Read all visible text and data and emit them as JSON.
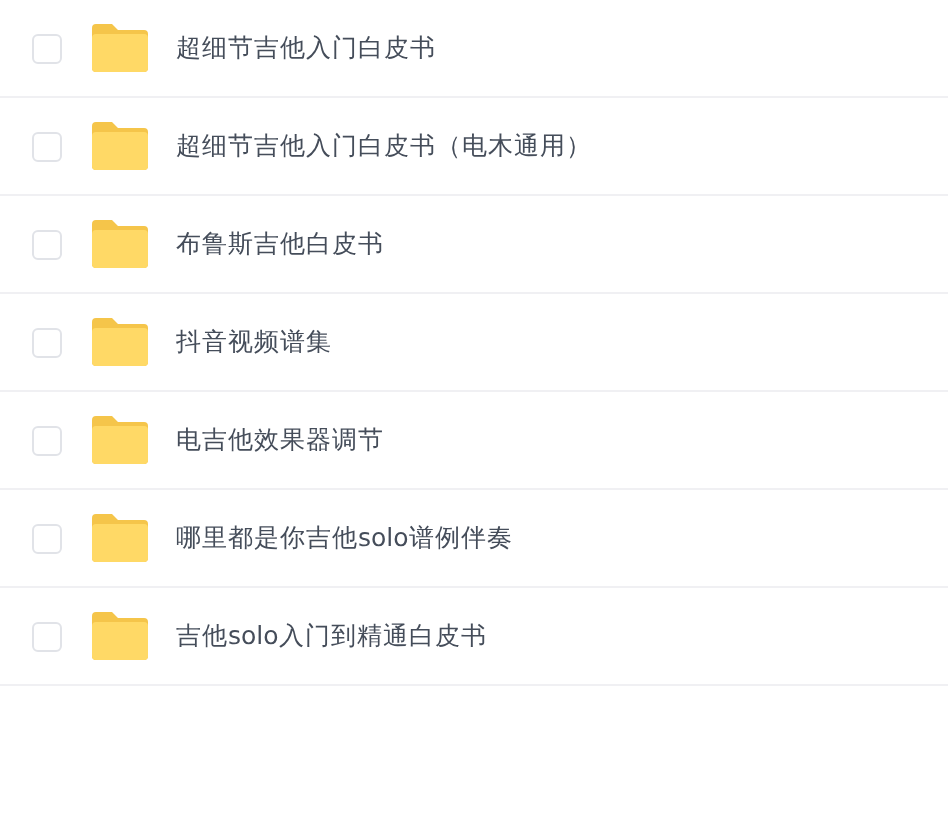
{
  "files": [
    {
      "name": "超细节吉他入门白皮书",
      "checked": false
    },
    {
      "name": "超细节吉他入门白皮书（电木通用）",
      "checked": false
    },
    {
      "name": "布鲁斯吉他白皮书",
      "checked": false
    },
    {
      "name": "抖音视频谱集",
      "checked": false
    },
    {
      "name": "电吉他效果器调节",
      "checked": false
    },
    {
      "name": "哪里都是你吉他solo谱例伴奏",
      "checked": false
    },
    {
      "name": "吉他solo入门到精通白皮书",
      "checked": false
    }
  ]
}
